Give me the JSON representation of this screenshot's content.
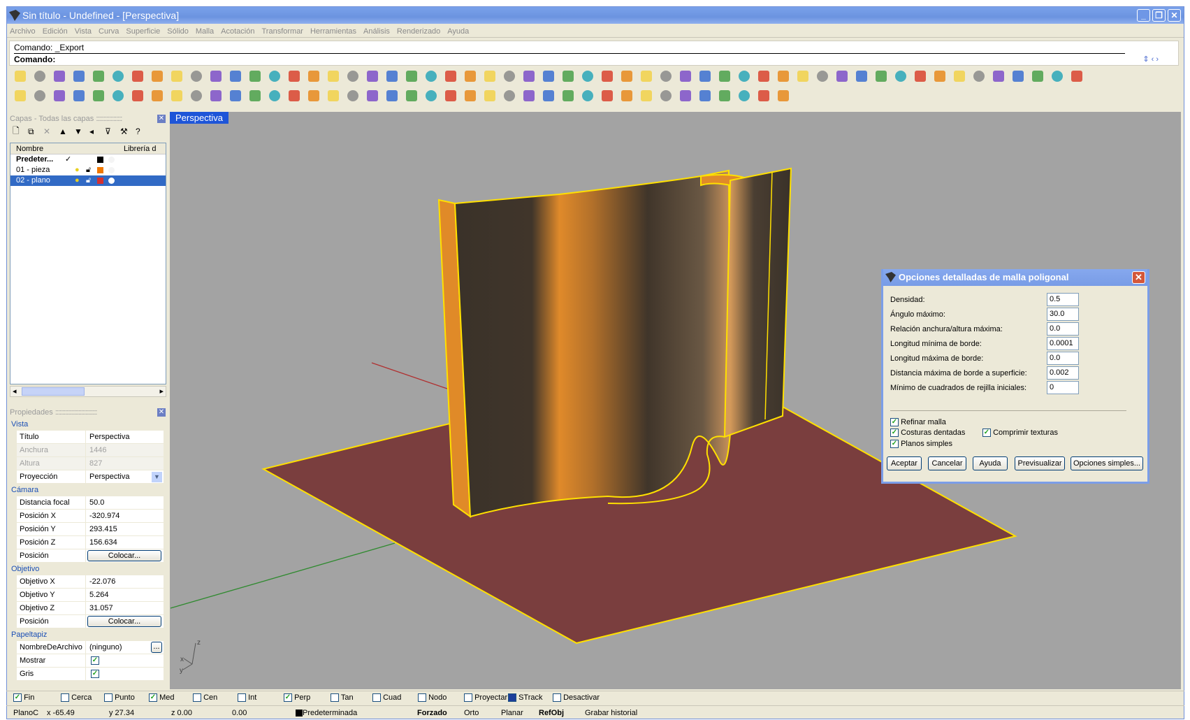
{
  "window": {
    "title": "Sin título - Undefined - [Perspectiva]",
    "buttons": [
      "minimize",
      "restore",
      "close"
    ]
  },
  "menu": [
    "Archivo",
    "Edición",
    "Vista",
    "Curva",
    "Superficie",
    "Sólido",
    "Malla",
    "Acotación",
    "Transformar",
    "Herramientas",
    "Análisis",
    "Renderizado",
    "Ayuda"
  ],
  "command": {
    "history": "Comando: _Export",
    "prompt": "Comando:"
  },
  "toolbar1": [
    "new-file-icon",
    "open-folder-icon",
    "save-icon",
    "print-icon",
    "template-icon",
    "cut-icon",
    "copy-icon",
    "paste-icon",
    "undo-icon",
    "pan-hand-icon",
    "rotate-view-icon",
    "zoom-icon",
    "zoom-window-icon",
    "zoom-extents-icon",
    "zoom-selected-icon",
    "undo-view-icon",
    "four-viewports-icon",
    "car-icon",
    "grid-icon",
    "point-icon",
    "select-points-icon",
    "light-bulb-icon",
    "lock-icon",
    "layer-icon",
    "color-wheel-icon",
    "wireframe-sphere-icon",
    "grid-sphere-icon",
    "shaded-sphere-icon",
    "render-icon",
    "gear-icon",
    "dimension-icon",
    "help-icon",
    "object-snap-icon",
    "control-points-icon",
    "contrast-icon",
    "box-yellow-icon",
    "curve-icon",
    "extrude-icon",
    "text-icon",
    "solid-icon",
    "rainbow-icon",
    "surface-icon",
    "points-cloud-icon",
    "points-grid-icon",
    "patch-icon",
    "pencil-icon",
    "trim-icon",
    "sphere-black-icon",
    "cylinder-icon",
    "eraser-icon",
    "plane-icon",
    "spiral-icon",
    "analysis-icon",
    "link-icon",
    "shape-icon"
  ],
  "toolbar2": [
    "save-red-icon",
    "line-icon",
    "polyline-icon",
    "rectangle-icon",
    "circle-icon",
    "arc-icon",
    "point-small-icon",
    "fillet-icon",
    "chamfer-icon",
    "blend-icon",
    "offset-icon",
    "trim-line-icon",
    "split-icon",
    "curve-edit-icon",
    "surface-patch-icon",
    "cylinder-surface-icon",
    "extrude-surface-icon",
    "loft-icon",
    "sweep-icon",
    "box-icon",
    "cube-icon",
    "boolean-icon",
    "dimension-line-icon",
    "explode-icon",
    "lightning-icon",
    "boolean-union-icon",
    "boolean-split-icon",
    "sphere-blue-icon",
    "intersect-icon",
    "wall-icon",
    "cube-blue-icon",
    "scale-icon",
    "array-icon",
    "mirror-icon",
    "solid-edit-icon",
    "section-icon",
    "ruler-icon",
    "mesh-icon",
    "mesh-grid-icon",
    "paint-icon"
  ],
  "layers": {
    "header": "Capas - Todas las capas",
    "tools": [
      "new-layer-icon",
      "copy-layer-icon",
      "delete-icon",
      "move-up-icon",
      "move-down-icon",
      "move-left-icon",
      "filter-icon",
      "tools-icon",
      "help-icon"
    ],
    "columns": [
      "Nombre",
      "Librería d"
    ],
    "rows": [
      {
        "name": "Predeter...",
        "current": "✓",
        "color": "#000000",
        "selected": false
      },
      {
        "name": "01 - pieza",
        "current": "",
        "color": "#f07800",
        "selected": false
      },
      {
        "name": "02 - plano",
        "current": "",
        "color": "#d43030",
        "selected": true
      }
    ]
  },
  "properties": {
    "header": "Propiedades",
    "vista": {
      "label": "Vista",
      "titulo_k": "Título",
      "titulo_v": "Perspectiva",
      "anchura_k": "Anchura",
      "anchura_v": "1446",
      "altura_k": "Altura",
      "altura_v": "827",
      "proy_k": "Proyección",
      "proy_v": "Perspectiva"
    },
    "camara": {
      "label": "Cámara",
      "focal_k": "Distancia focal",
      "focal_v": "50.0",
      "px_k": "Posición X",
      "px_v": "-320.974",
      "py_k": "Posición Y",
      "py_v": "293.415",
      "pz_k": "Posición Z",
      "pz_v": "156.634",
      "pos_k": "Posición",
      "pos_btn": "Colocar..."
    },
    "objetivo": {
      "label": "Objetivo",
      "ox_k": "Objetivo X",
      "ox_v": "-22.076",
      "oy_k": "Objetivo Y",
      "oy_v": "5.264",
      "oz_k": "Objetivo Z",
      "oz_v": "31.057",
      "pos_k": "Posición",
      "pos_btn": "Colocar..."
    },
    "papeltapiz": {
      "label": "Papeltapiz",
      "file_k": "NombreDeArchivo",
      "file_v": "(ninguno)",
      "file_btn": "...",
      "mostrar_k": "Mostrar",
      "mostrar_v": true,
      "gris_k": "Gris",
      "gris_v": true
    }
  },
  "viewport": {
    "tab": "Perspectiva",
    "axis_labels": {
      "z": "z",
      "x": "x",
      "y": "y"
    },
    "colors": {
      "plane": "#7a3e3e",
      "wall_orange": "#e0882a",
      "outline": "#ffe000",
      "x_axis": "#b03030",
      "y_axis": "#2f8a2f"
    }
  },
  "dialog": {
    "title": "Opciones detalladas de malla poligonal",
    "fields": [
      {
        "label": "Densidad:",
        "value": "0.5"
      },
      {
        "label": "Ángulo máximo:",
        "value": "30.0"
      },
      {
        "label": "Relación anchura/altura máxima:",
        "value": "0.0"
      },
      {
        "label": "Longitud mínima de borde:",
        "value": "0.0001"
      },
      {
        "label": "Longitud máxima de borde:",
        "value": "0.0"
      },
      {
        "label": "Distancia máxima de borde a superficie:",
        "value": "0.002"
      },
      {
        "label": "Mínimo de cuadrados de rejilla iniciales:",
        "value": "0"
      }
    ],
    "checks": {
      "refinar": "Refinar malla",
      "costuras": "Costuras dentadas",
      "comprimir": "Comprimir texturas",
      "planos": "Planos simples"
    },
    "buttons": {
      "aceptar": "Aceptar",
      "cancelar": "Cancelar",
      "ayuda": "Ayuda",
      "previsualizar": "Previsualizar",
      "simples": "Opciones simples..."
    }
  },
  "osnap": [
    {
      "label": "Fin",
      "checked": true
    },
    {
      "label": "Cerca",
      "checked": false
    },
    {
      "label": "Punto",
      "checked": false
    },
    {
      "label": "Med",
      "checked": true
    },
    {
      "label": "Cen",
      "checked": false
    },
    {
      "label": "Int",
      "checked": false
    },
    {
      "label": "Perp",
      "checked": true
    },
    {
      "label": "Tan",
      "checked": false
    },
    {
      "label": "Cuad",
      "checked": false
    },
    {
      "label": "Nodo",
      "checked": false
    },
    {
      "label": "Proyectar",
      "checked": false
    },
    {
      "label": "STrack",
      "checked": true
    },
    {
      "label": "Desactivar",
      "checked": false
    }
  ],
  "status": {
    "plane": "PlanoC",
    "x": "x -65.49",
    "y": "y 27.34",
    "z": "z 0.00",
    "d": "0.00",
    "layer": "Predeterminada",
    "forzado": "Forzado",
    "orto": "Orto",
    "planar": "Planar",
    "refobj": "RefObj",
    "historial": "Grabar historial"
  }
}
